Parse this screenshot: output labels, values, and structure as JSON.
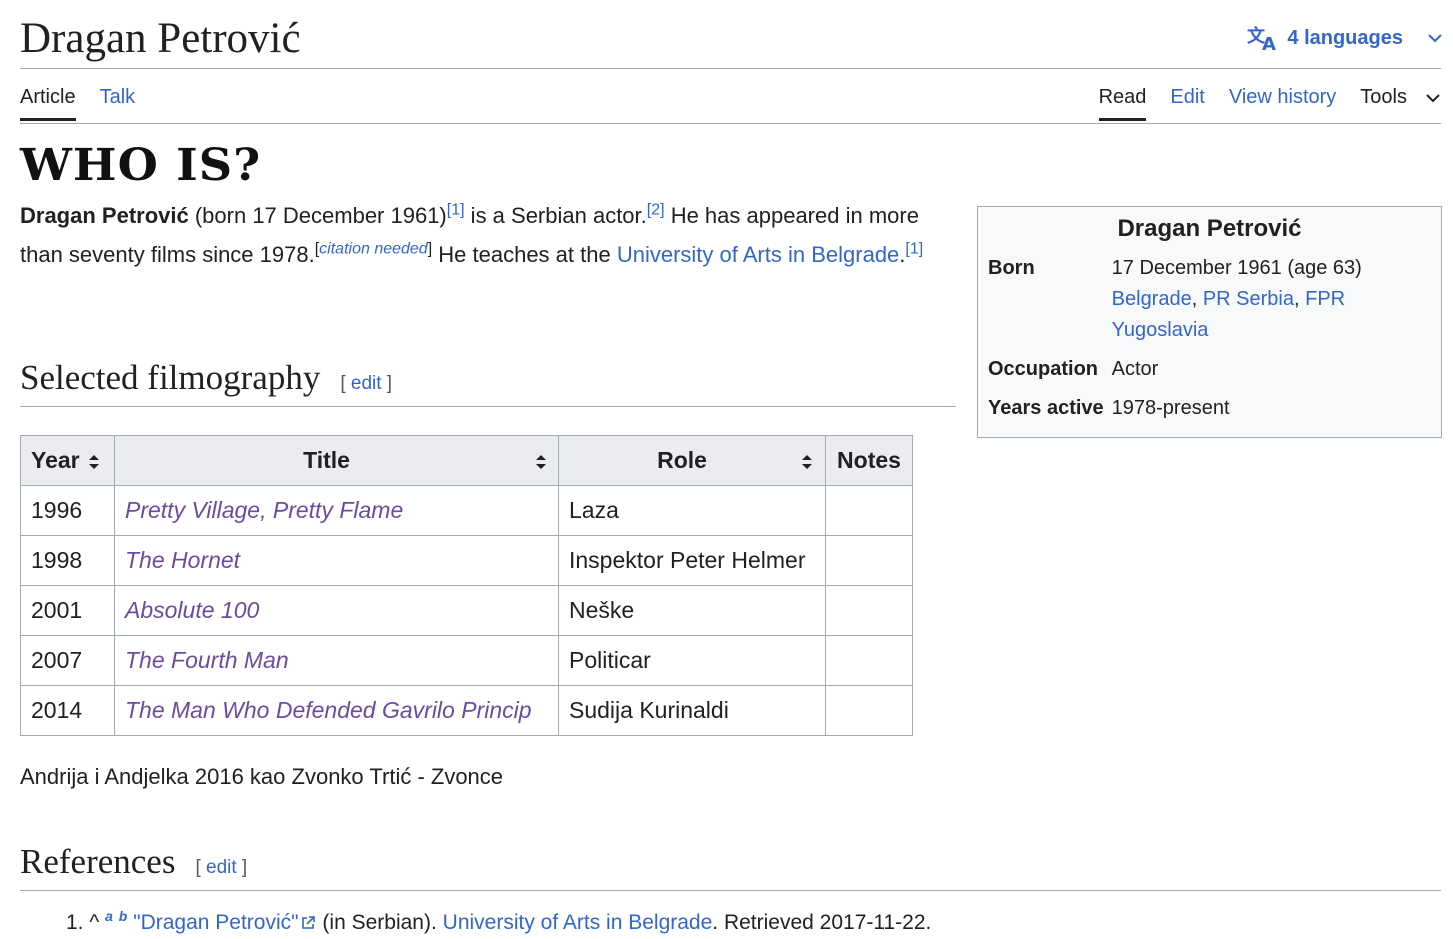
{
  "page": {
    "title": "Dragan Petrović",
    "languages_label": "4 languages",
    "logo_text": "WHO IS?"
  },
  "tabs_left": [
    {
      "label": "Article",
      "active": true
    },
    {
      "label": "Talk",
      "active": false
    }
  ],
  "tabs_right": [
    {
      "label": "Read",
      "active": true
    },
    {
      "label": "Edit",
      "active": false
    },
    {
      "label": "View history",
      "active": false
    },
    {
      "label": "Tools",
      "active": false
    }
  ],
  "intro": {
    "name": "Dragan Petrović",
    "born_text": " (born 17 December 1961)",
    "ref1": "[1]",
    "actor_text": " is a Serbian actor.",
    "ref2": "[2]",
    "films_text": " He has appeared in more than seventy films since 1978.",
    "cn_open": "[",
    "cn_label": "citation needed",
    "cn_close": "]",
    "teaches_text": " He teaches at the ",
    "university_link": "University of Arts in Belgrade",
    "period": ".",
    "ref3": "[1]"
  },
  "infobox": {
    "title": "Dragan Petrović",
    "born_label": "Born",
    "born_date": "17 December 1961 (age 63)",
    "born_place_1": "Belgrade",
    "sep_1": ", ",
    "born_place_2": "PR Serbia",
    "sep_2": ", ",
    "born_place_3": "FPR Yugoslavia",
    "occupation_label": "Occupation",
    "occupation_value": "Actor",
    "years_label": "Years active",
    "years_value": "1978-present"
  },
  "filmography": {
    "heading": "Selected filmography",
    "edit_open": "[ ",
    "edit_label": "edit",
    "edit_close": " ]",
    "headers": {
      "year": "Year",
      "title": "Title",
      "role": "Role",
      "notes": "Notes"
    },
    "rows": [
      {
        "year": "1996",
        "title": "Pretty Village, Pretty Flame",
        "role": "Laza",
        "notes": ""
      },
      {
        "year": "1998",
        "title": "The Hornet",
        "role": "Inspektor Peter Helmer",
        "notes": ""
      },
      {
        "year": "2001",
        "title": "Absolute 100",
        "role": "Neške",
        "notes": ""
      },
      {
        "year": "2007",
        "title": "The Fourth Man",
        "role": "Politicar",
        "notes": ""
      },
      {
        "year": "2014",
        "title": "The Man Who Defended Gavrilo Princip",
        "role": "Sudija Kurinaldi",
        "notes": ""
      }
    ],
    "extra_line": "Andrija i Andjelka 2016 kao Zvonko Trtić - Zvonce"
  },
  "references": {
    "heading": "References",
    "edit_open": "[ ",
    "edit_label": "edit",
    "edit_close": " ]",
    "items": [
      {
        "number": "1.",
        "caret": "^",
        "backlink_a": "a",
        "backlink_b": "b",
        "link_title": "\"Dragan Petrović\"",
        "lang_note": " (in Serbian). ",
        "publisher": "University of Arts in Belgrade",
        "retrieved": ". Retrieved 2017-11-22."
      }
    ]
  },
  "colors": {
    "link": "#3366cc",
    "visited_link": "#6b4ba1",
    "text": "#202122",
    "border": "#a2a9b1",
    "table_header_bg": "#eaecf0",
    "infobox_bg": "#f8f9fa"
  }
}
